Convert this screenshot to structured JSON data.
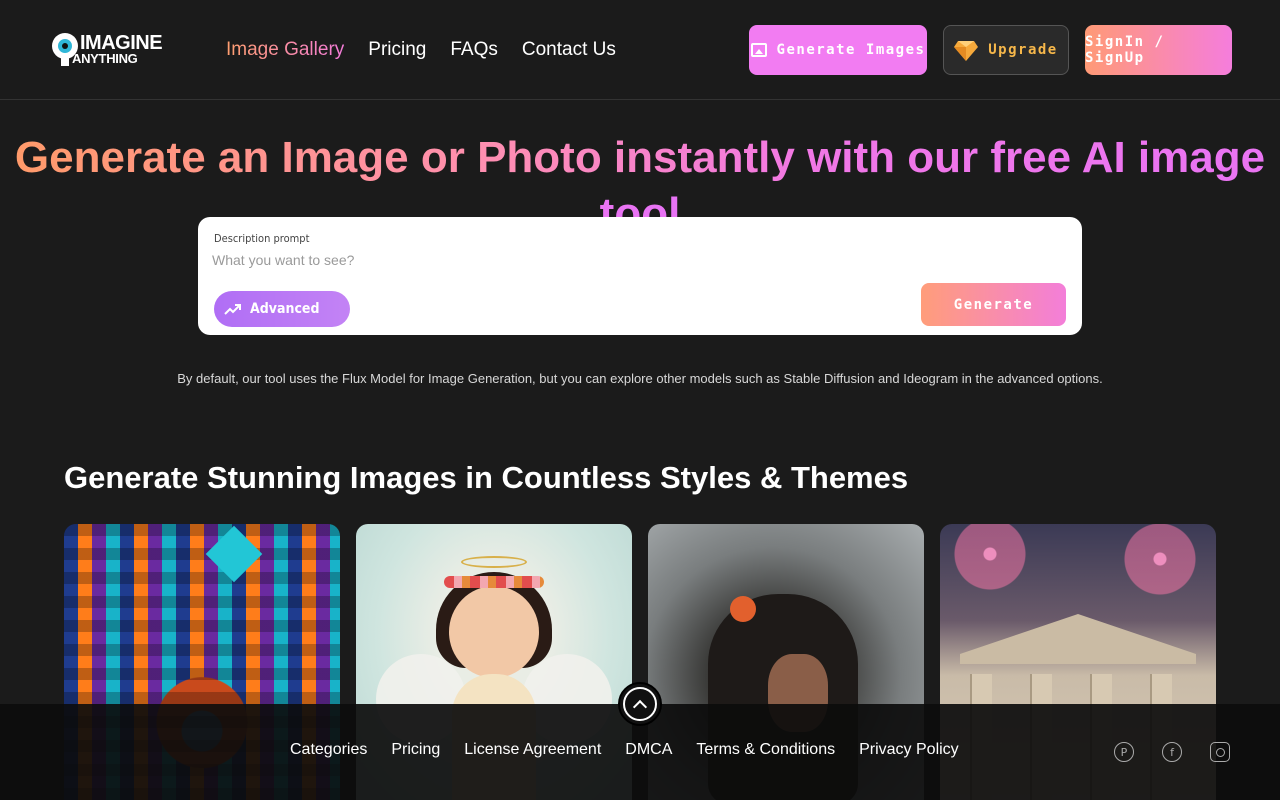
{
  "brand": {
    "line1": "IMAGINE",
    "line2": "ANYTHING"
  },
  "nav": [
    {
      "label": "Image Gallery",
      "active": true
    },
    {
      "label": "Pricing",
      "active": false
    },
    {
      "label": "FAQs",
      "active": false
    },
    {
      "label": "Contact Us",
      "active": false
    }
  ],
  "header_buttons": {
    "generate": "Generate Images",
    "upgrade": "Upgrade",
    "signin": "SignIn / SignUp"
  },
  "hero": {
    "title": "Generate an Image or Photo instantly with our free AI image tool"
  },
  "prompt": {
    "label": "Description prompt",
    "placeholder": "What you want to see?",
    "value": "",
    "advanced_label": "Advanced",
    "generate_label": "Generate"
  },
  "note": "By default, our tool uses the Flux Model for Image Generation, but you can explore other models such as Stable Diffusion and Ideogram in the advanced options.",
  "gallery": {
    "title": "Generate Stunning Images in Countless Styles & Themes"
  },
  "footer": {
    "links": [
      "Categories",
      "Pricing",
      "License Agreement",
      "DMCA",
      "Terms & Conditions",
      "Privacy Policy"
    ],
    "social_icons": [
      "pinterest-icon",
      "facebook-icon",
      "instagram-icon"
    ]
  },
  "colors": {
    "background": "#1b1b1b",
    "accent_pink": "#f27cf2",
    "accent_orange": "#ff9a76",
    "upgrade_text": "#f6b74a",
    "advanced_purple": "#b06ef5"
  }
}
